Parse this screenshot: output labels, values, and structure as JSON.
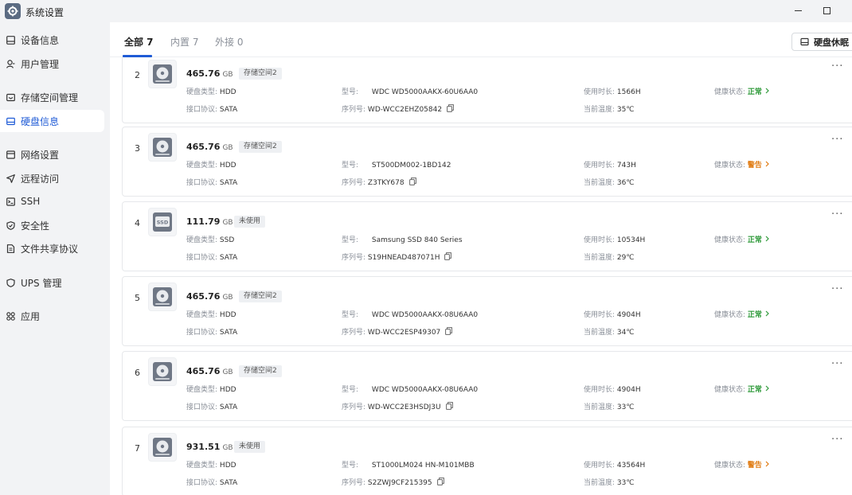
{
  "window": {
    "title": "系统设置",
    "app_icon": "gear-icon"
  },
  "sidebar": {
    "items": [
      {
        "label": "设备信息",
        "icon": "device-info-icon"
      },
      {
        "label": "用户管理",
        "icon": "user-icon"
      },
      {
        "label": "存储空间管理",
        "icon": "storage-icon"
      },
      {
        "label": "硬盘信息",
        "icon": "disk-icon",
        "active": true
      },
      {
        "label": "网络设置",
        "icon": "network-icon"
      },
      {
        "label": "远程访问",
        "icon": "send-icon"
      },
      {
        "label": "SSH",
        "icon": "terminal-icon"
      },
      {
        "label": "安全性",
        "icon": "shield-icon"
      },
      {
        "label": "文件共享协议",
        "icon": "file-icon"
      },
      {
        "label": "UPS 管理",
        "icon": "ups-shield-icon"
      },
      {
        "label": "应用",
        "icon": "apps-icon"
      }
    ]
  },
  "tabs": [
    {
      "label": "全部 7",
      "active": true
    },
    {
      "label": "内置 7"
    },
    {
      "label": "外接 0"
    }
  ],
  "sleep_button": {
    "label": "硬盘休眠",
    "icon": "disk-sleep-icon"
  },
  "labels": {
    "type": "硬盘类型:",
    "protocol": "接口协议:",
    "model": "型号:",
    "serial": "序列号:",
    "uptime": "使用时长:",
    "temp": "当前温度:",
    "health": "健康状态:",
    "more": "···"
  },
  "colors": {
    "accent": "#1f5bd6",
    "ok": "#2f9a3a",
    "warn": "#e07b12"
  },
  "disks": [
    {
      "num": "2",
      "capacity": "465.76",
      "unit": "GB",
      "badge": "存储空间2",
      "type": "HDD",
      "protocol": "SATA",
      "model": "WDC WD5000AAKX-60U6AA0",
      "serial": "WD-WCC2EHZ05842",
      "uptime": "1566H",
      "temp": "35℃",
      "health": "正常",
      "health_level": "ok",
      "kind": "hdd"
    },
    {
      "num": "3",
      "capacity": "465.76",
      "unit": "GB",
      "badge": "存储空间2",
      "type": "HDD",
      "protocol": "SATA",
      "model": "ST500DM002-1BD142",
      "serial": "Z3TKY678",
      "uptime": "743H",
      "temp": "36℃",
      "health": "警告",
      "health_level": "warn",
      "kind": "hdd"
    },
    {
      "num": "4",
      "capacity": "111.79",
      "unit": "GB",
      "badge": "未使用",
      "type": "SSD",
      "protocol": "SATA",
      "model": "Samsung SSD 840 Series",
      "serial": "S19HNEAD487071H",
      "uptime": "10534H",
      "temp": "29℃",
      "health": "正常",
      "health_level": "ok",
      "kind": "ssd",
      "ssd_label": "SSD"
    },
    {
      "num": "5",
      "capacity": "465.76",
      "unit": "GB",
      "badge": "存储空间2",
      "type": "HDD",
      "protocol": "SATA",
      "model": "WDC WD5000AAKX-08U6AA0",
      "serial": "WD-WCC2ESP49307",
      "uptime": "4904H",
      "temp": "34℃",
      "health": "正常",
      "health_level": "ok",
      "kind": "hdd"
    },
    {
      "num": "6",
      "capacity": "465.76",
      "unit": "GB",
      "badge": "存储空间2",
      "type": "HDD",
      "protocol": "SATA",
      "model": "WDC WD5000AAKX-08U6AA0",
      "serial": "WD-WCC2E3HSDJ3U",
      "uptime": "4904H",
      "temp": "33℃",
      "health": "正常",
      "health_level": "ok",
      "kind": "hdd"
    },
    {
      "num": "7",
      "capacity": "931.51",
      "unit": "GB",
      "badge": "未使用",
      "type": "HDD",
      "protocol": "SATA",
      "model": "ST1000LM024 HN-M101MBB",
      "serial": "S2ZWJ9CF215395",
      "uptime": "43564H",
      "temp": "33℃",
      "health": "警告",
      "health_level": "warn",
      "kind": "hdd"
    }
  ]
}
